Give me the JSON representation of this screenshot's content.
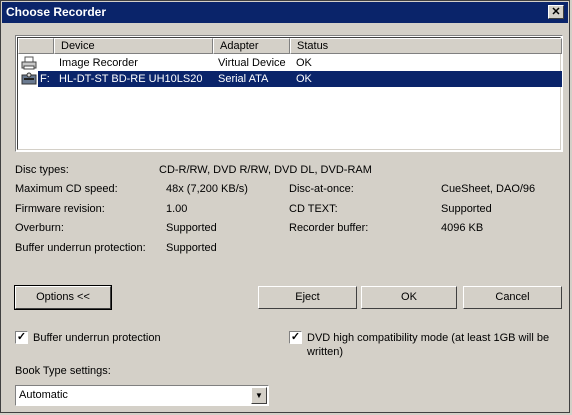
{
  "window": {
    "title": "Choose Recorder",
    "close_glyph": "✕"
  },
  "list": {
    "columns": [
      "Device",
      "Adapter",
      "Status"
    ],
    "rows": [
      {
        "icon": "printer-icon",
        "drive": "",
        "device": "Image Recorder",
        "adapter": "Virtual Device",
        "status": "OK",
        "selected": false
      },
      {
        "icon": "optical-drive-icon",
        "drive": "F:",
        "device": "HL-DT-ST BD-RE  UH10LS20",
        "adapter": "Serial ATA",
        "status": "OK",
        "selected": true
      }
    ]
  },
  "info": {
    "disc_types_label": "Disc types:",
    "disc_types_value": "CD-R/RW, DVD R/RW, DVD DL, DVD-RAM",
    "max_speed_label": "Maximum CD speed:",
    "max_speed_value": "48x (7,200 KB/s)",
    "firmware_label": "Firmware revision:",
    "firmware_value": "1.00",
    "overburn_label": "Overburn:",
    "overburn_value": "Supported",
    "buffer_protect_label": "Buffer underrun protection:",
    "buffer_protect_value": "Supported",
    "dao_label": "Disc-at-once:",
    "dao_value": "CueSheet, DAO/96",
    "cdtext_label": "CD TEXT:",
    "cdtext_value": "Supported",
    "recorder_buffer_label": "Recorder buffer:",
    "recorder_buffer_value": "4096 KB"
  },
  "buttons": {
    "options": "Options <<",
    "eject": "Eject",
    "ok": "OK",
    "cancel": "Cancel"
  },
  "options": {
    "buffer_underrun_label": "Buffer underrun protection",
    "buffer_underrun_checked": true,
    "dvd_compat_label_1": "DVD high compatibility mode (at least 1GB will be",
    "dvd_compat_label_2": "written)",
    "dvd_compat_checked": true,
    "check_glyph": "✓",
    "book_type_label": "Book Type settings:",
    "book_type_value": "Automatic",
    "dropdown_glyph": "▼"
  }
}
